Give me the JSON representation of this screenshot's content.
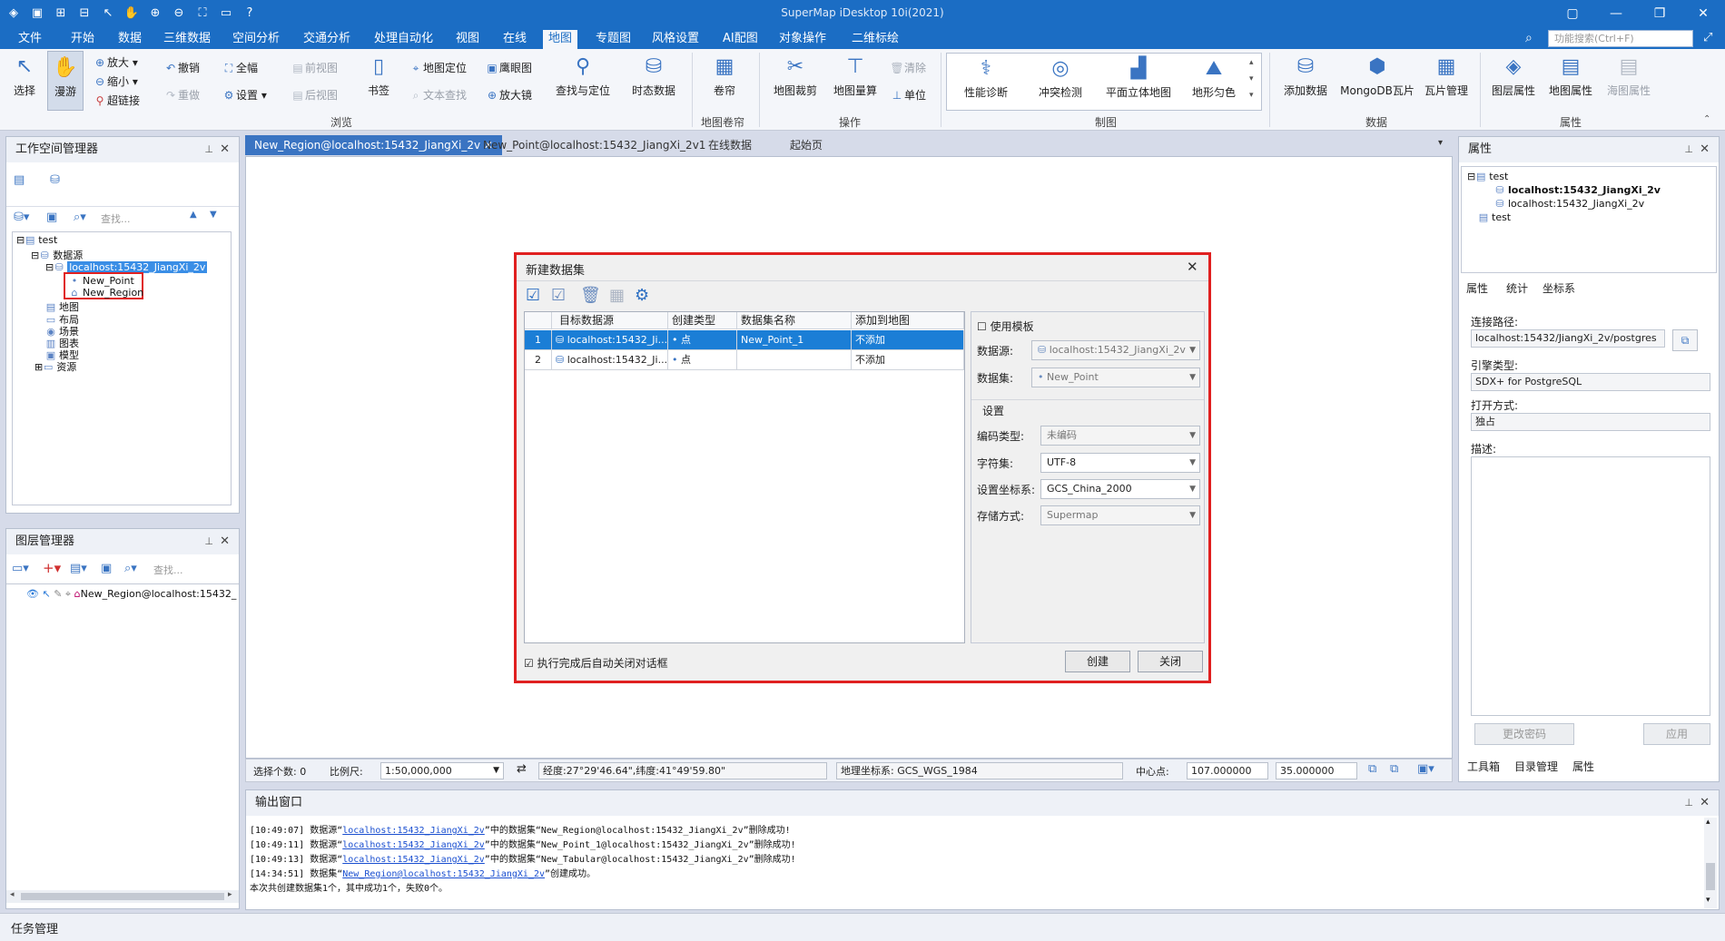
{
  "app": {
    "title": "SuperMap iDesktop 10i(2021)"
  },
  "menu": {
    "items": [
      "文件",
      "开始",
      "数据",
      "三维数据",
      "空间分析",
      "交通分析",
      "处理自动化",
      "视图",
      "在线",
      "地图",
      "专题图",
      "风格设置",
      "AI配图",
      "对象操作",
      "二维标绘"
    ],
    "active": "地图",
    "search_placeholder": "功能搜索(Ctrl+F)"
  },
  "ribbon": {
    "browse": {
      "label": "浏览",
      "select": "选择",
      "pan": "漫游",
      "zoom_in": "放大",
      "zoom_out": "缩小",
      "hyperlink": "超链接",
      "undo": "撤销",
      "redo": "重做",
      "full": "全幅",
      "settings": "设置",
      "prev_view": "前视图",
      "next_view": "后视图",
      "bookmark": "书签",
      "locate": "地图定位",
      "text_find": "文本查找",
      "eagle": "鹰眼图",
      "magnifier": "放大镜",
      "find_locate": "查找与定位",
      "temporal": "时态数据"
    },
    "swipe": {
      "label": "地图卷帘",
      "swipe": "卷帘"
    },
    "operate": {
      "label": "操作",
      "clip": "地图裁剪",
      "measure": "地图量算",
      "clear": "清除",
      "unit": "单位"
    },
    "mapping": {
      "label": "制图",
      "perf": "性能诊断",
      "conflict": "冲突检测",
      "flat3d": "平面立体地图",
      "terrain": "地形匀色"
    },
    "data": {
      "label": "数据",
      "add": "添加数据",
      "mongo": "MongoDB瓦片",
      "tile": "瓦片管理"
    },
    "props": {
      "label": "属性",
      "layer": "图层属性",
      "map": "地图属性",
      "chart": "海图属性"
    }
  },
  "workspace": {
    "title": "工作空间管理器",
    "search_placeholder": "查找...",
    "tree": {
      "root": "test",
      "datasources": "数据源",
      "ds1": "localhost:15432_JiangXi_2v",
      "new_point": "New_Point",
      "new_region": "New_Region",
      "maps": "地图",
      "layouts": "布局",
      "scenes": "场景",
      "charts": "图表",
      "models": "模型",
      "resources": "资源"
    }
  },
  "layers": {
    "title": "图层管理器",
    "search_placeholder": "查找...",
    "layer1": "New_Region@localhost:15432_"
  },
  "tabs": [
    "New_Region@localhost:15432_JiangXi_2v",
    "New_Point@localhost:15432_JiangXi_2v1",
    "在线数据",
    "起始页"
  ],
  "dialog": {
    "title": "新建数据集",
    "columns": [
      "目标数据源",
      "创建类型",
      "数据集名称",
      "添加到地图"
    ],
    "rows": [
      {
        "n": "1",
        "ds": "localhost:15432_Ji...",
        "type": "点",
        "name": "New_Point_1",
        "add": "不添加"
      },
      {
        "n": "2",
        "ds": "localhost:15432_Ji...",
        "type": "点",
        "name": "",
        "add": "不添加"
      }
    ],
    "use_template": "使用模板",
    "tpl_ds_label": "数据源:",
    "tpl_ds": "localhost:15432_JiangXi_2v",
    "tpl_set_label": "数据集:",
    "tpl_set": "New_Point",
    "settings": "设置",
    "encode_label": "编码类型:",
    "encode": "未编码",
    "charset_label": "字符集:",
    "charset": "UTF-8",
    "crs_label": "设置坐标系:",
    "crs": "GCS_China_2000",
    "storage_label": "存储方式:",
    "storage": "Supermap",
    "auto_close": "执行完成后自动关闭对话框",
    "create": "创建",
    "close": "关闭"
  },
  "status": {
    "sel_count": "选择个数: 0",
    "scale_label": "比例尺:",
    "scale": "1:50,000,000",
    "coords": "经度:27°29'46.64\",纬度:41°49'59.80\"",
    "geo_crs": "地理坐标系: GCS_WGS_1984",
    "center_label": "中心点:",
    "cx": "107.000000",
    "cy": "35.000000"
  },
  "output": {
    "title": "输出窗口",
    "lines": [
      {
        "pre": "[10:49:07] 数据源“",
        "link": "localhost:15432_JiangXi_2v",
        "post": "”中的数据集“New_Region@localhost:15432_JiangXi_2v”删除成功!"
      },
      {
        "pre": "[10:49:11] 数据源“",
        "link": "localhost:15432_JiangXi_2v",
        "post": "”中的数据集“New_Point_1@localhost:15432_JiangXi_2v”删除成功!"
      },
      {
        "pre": "[10:49:13] 数据源“",
        "link": "localhost:15432_JiangXi_2v",
        "post": "”中的数据集“New_Tabular@localhost:15432_JiangXi_2v”删除成功!"
      },
      {
        "pre": "[14:34:51] 数据集“",
        "link": "New_Region@localhost:15432_JiangXi_2v",
        "post": "”创建成功。"
      },
      {
        "pre": "本次共创建数据集1个，其中成功1个，失败0个。",
        "link": "",
        "post": ""
      }
    ]
  },
  "task": {
    "title": "任务管理"
  },
  "properties": {
    "title": "属性",
    "tree": {
      "root": "test",
      "ds1": "localhost:15432_JiangXi_2v",
      "ds2": "localhost:15432_JiangXi_2v",
      "root2": "test"
    },
    "tabs": [
      "属性",
      "统计",
      "坐标系"
    ],
    "conn_label": "连接路径:",
    "conn": "localhost:15432/JiangXi_2v/postgres",
    "engine_label": "引擎类型:",
    "engine": "SDX+ for PostgreSQL",
    "open_label": "打开方式:",
    "open": "独占",
    "desc_label": "描述:",
    "change_pwd": "更改密码",
    "apply": "应用",
    "bottom_tabs": [
      "工具箱",
      "目录管理",
      "属性"
    ]
  }
}
